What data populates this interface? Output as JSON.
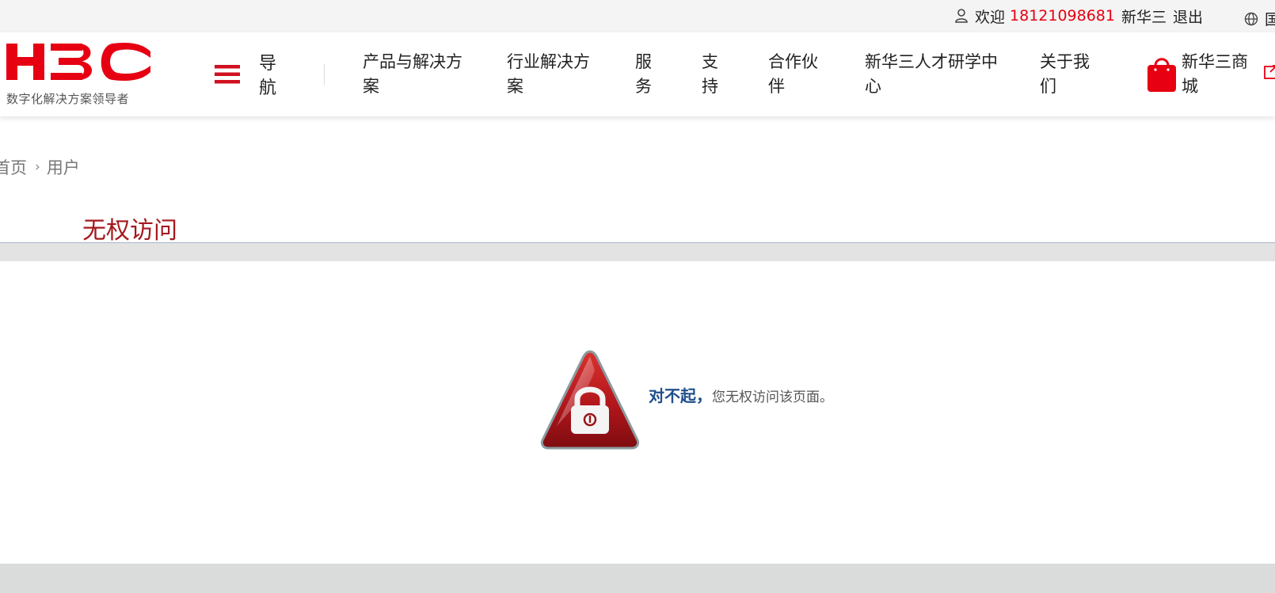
{
  "topbar": {
    "welcome": "欢迎",
    "phone": "18121098681",
    "brand": "新华三",
    "logout": "退出",
    "lang": "国"
  },
  "header": {
    "logo_slogan": "数字化解决方案领导者",
    "menu_label": "导航",
    "nav": [
      {
        "label": "产品与解决方案"
      },
      {
        "label": "行业解决方案"
      },
      {
        "label": "服务"
      },
      {
        "label": "支持"
      },
      {
        "label": "合作伙伴"
      },
      {
        "label": "新华三人才研学中心"
      },
      {
        "label": "关于我们"
      }
    ],
    "mall_label": "新华三商城"
  },
  "breadcrumb": {
    "home": "首页",
    "separator": "›",
    "current": "用户"
  },
  "page_title": "无权访问",
  "denied": {
    "sorry": "对不起，",
    "message": "您无权访问该页面。"
  },
  "colors": {
    "brand_red": "#e60012",
    "title_red": "#a4181e",
    "link_blue": "#1f4e8c"
  },
  "icons": [
    "user-icon",
    "globe-icon",
    "menu-icon",
    "shopping-bag-icon",
    "external-link-icon",
    "lock-warning-icon"
  ]
}
